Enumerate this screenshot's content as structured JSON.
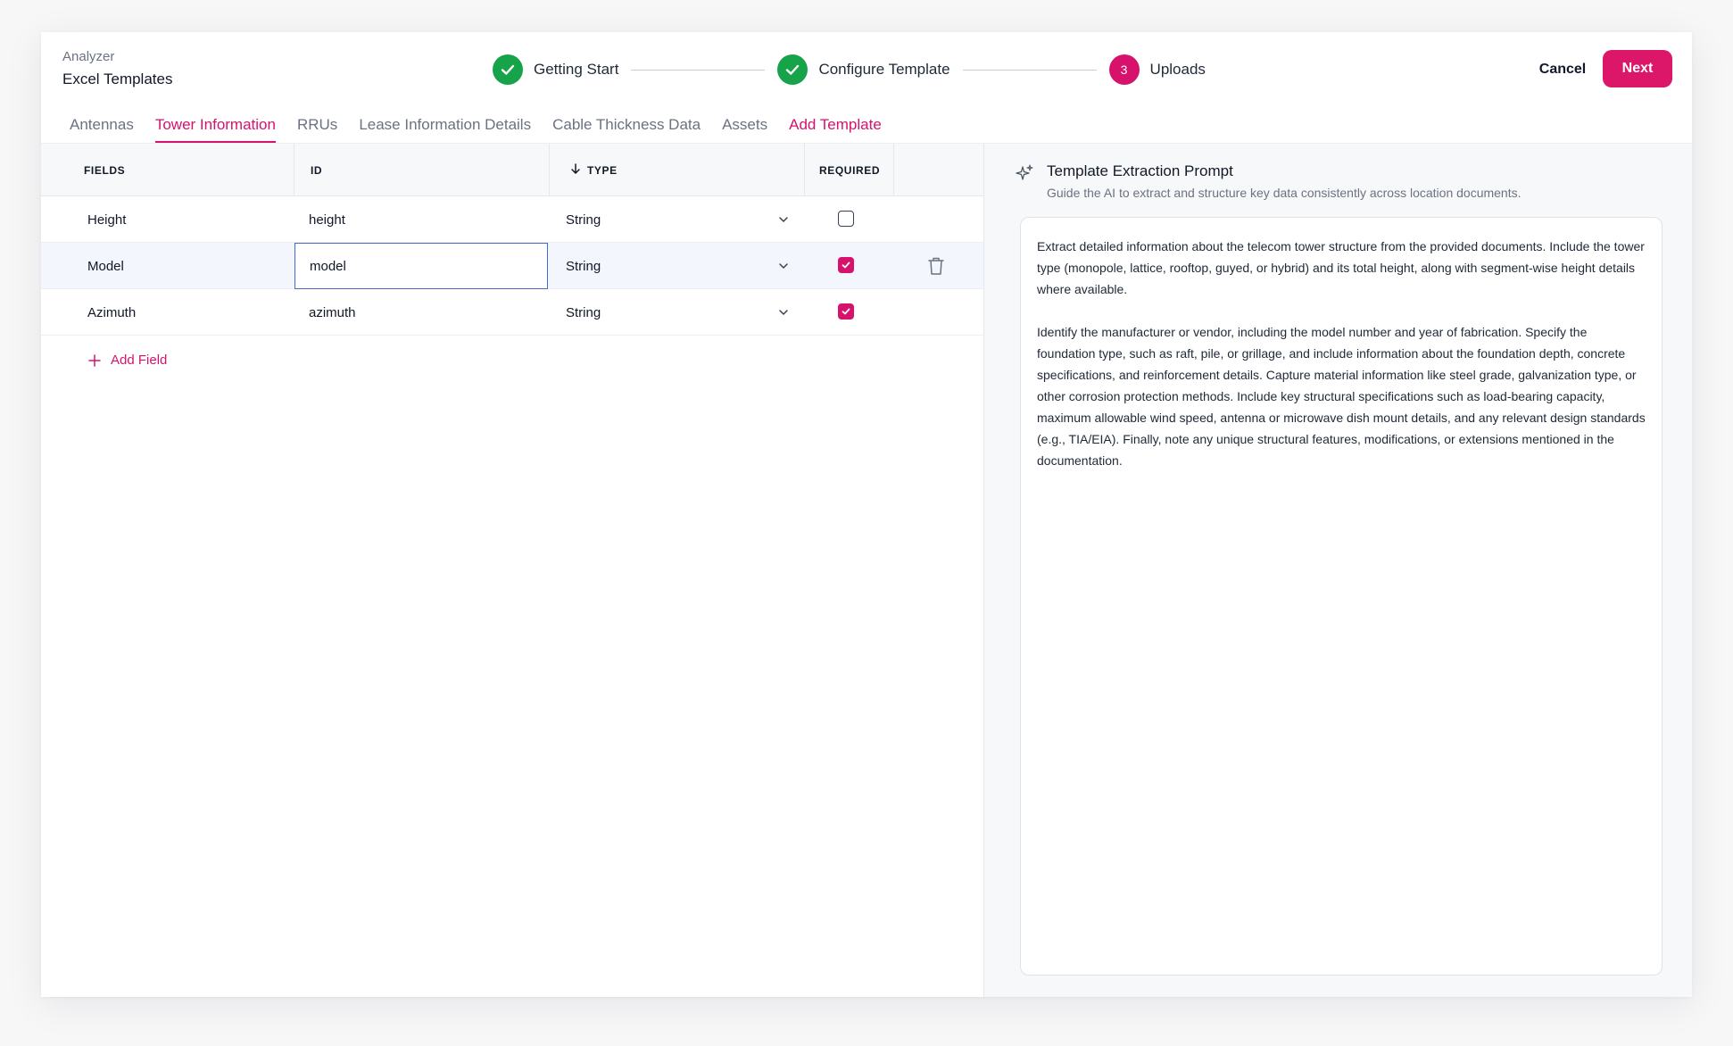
{
  "header": {
    "breadcrumb": "Analyzer",
    "title": "Excel Templates",
    "steps": [
      {
        "label": "Getting Start",
        "state": "done"
      },
      {
        "label": "Configure Template",
        "state": "done"
      },
      {
        "label": "Uploads",
        "state": "current",
        "number": "3"
      }
    ],
    "cancel_label": "Cancel",
    "next_label": "Next"
  },
  "tabs": [
    {
      "label": "Antennas",
      "active": false
    },
    {
      "label": "Tower Information",
      "active": true
    },
    {
      "label": "RRUs",
      "active": false
    },
    {
      "label": "Lease Information Details",
      "active": false
    },
    {
      "label": "Cable Thickness Data",
      "active": false
    },
    {
      "label": "Assets",
      "active": false
    }
  ],
  "add_template_label": "Add Template",
  "table": {
    "columns": {
      "fields": "FIELDS",
      "id": "ID",
      "type": "TYPE",
      "required": "REQUIRED"
    },
    "rows": [
      {
        "field": "Height",
        "id": "height",
        "type": "String",
        "required": false
      },
      {
        "field": "Model",
        "id": "model",
        "type": "String",
        "required": true
      },
      {
        "field": "Azimuth",
        "id": "azimuth",
        "type": "String",
        "required": true
      }
    ],
    "add_field_label": "Add Field"
  },
  "panel": {
    "title": "Template Extraction Prompt",
    "subtitle": "Guide the AI to extract and structure key data consistently across location documents.",
    "prompt_p1": "Extract detailed information about the telecom tower structure from the provided documents. Include the tower type (monopole, lattice, rooftop, guyed, or hybrid) and its total height, along with segment-wise height details where available.",
    "prompt_p2": "Identify the manufacturer or vendor, including the model number and year of fabrication. Specify the foundation type, such as raft, pile, or grillage, and include information about the foundation depth, concrete specifications, and reinforcement details. Capture material information like steel grade, galvanization type, or other corrosion protection methods. Include key structural specifications such as load-bearing capacity, maximum allowable wind speed, antenna or microwave dish mount details, and any relevant design standards (e.g., TIA/EIA). Finally, note any unique structural features, modifications, or extensions mentioned in the documentation."
  },
  "colors": {
    "accent": "#d6126d",
    "success": "#16a34a",
    "focus_border": "#4a67c9"
  }
}
